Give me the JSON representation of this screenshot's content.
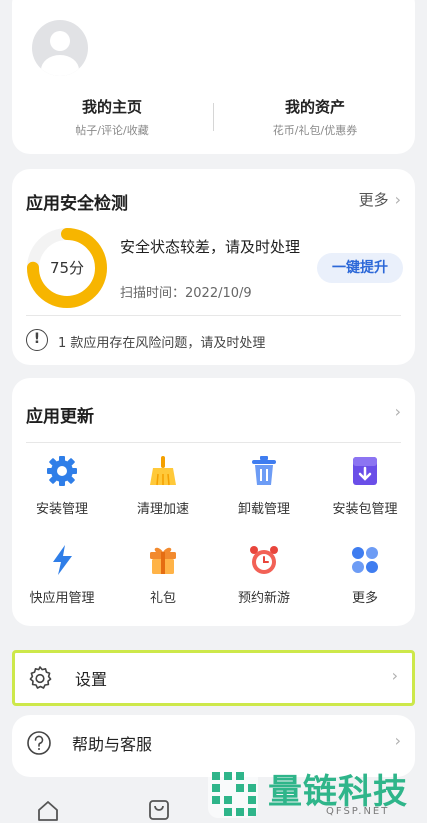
{
  "profile": {
    "home_title": "我的主页",
    "home_sub": "帖子/评论/收藏",
    "assets_title": "我的资产",
    "assets_sub": "花币/礼包/优惠券"
  },
  "security": {
    "title": "应用安全检测",
    "more_label": "更多",
    "score_label": "75分",
    "score_value": 75,
    "status_text": "安全状态较差，请及时处理",
    "scan_time": "扫描时间：2022/10/9",
    "fix_button": "一键提升",
    "warning_text": "1 款应用存在风险问题，请及时处理",
    "ring_color": "#f7b500"
  },
  "updates": {
    "title": "应用更新",
    "items": [
      {
        "label": "安装管理",
        "icon": "gear-icon"
      },
      {
        "label": "清理加速",
        "icon": "broom-icon"
      },
      {
        "label": "卸载管理",
        "icon": "trash-icon"
      },
      {
        "label": "安装包管理",
        "icon": "package-download-icon"
      },
      {
        "label": "快应用管理",
        "icon": "lightning-icon"
      },
      {
        "label": "礼包",
        "icon": "gift-icon"
      },
      {
        "label": "预约新游",
        "icon": "alarm-clock-icon"
      },
      {
        "label": "更多",
        "icon": "four-petal-icon"
      }
    ]
  },
  "settings": {
    "label": "设置"
  },
  "help": {
    "label": "帮助与客服"
  },
  "watermark": {
    "text": "量链科技",
    "url": "QFSP.NET"
  }
}
